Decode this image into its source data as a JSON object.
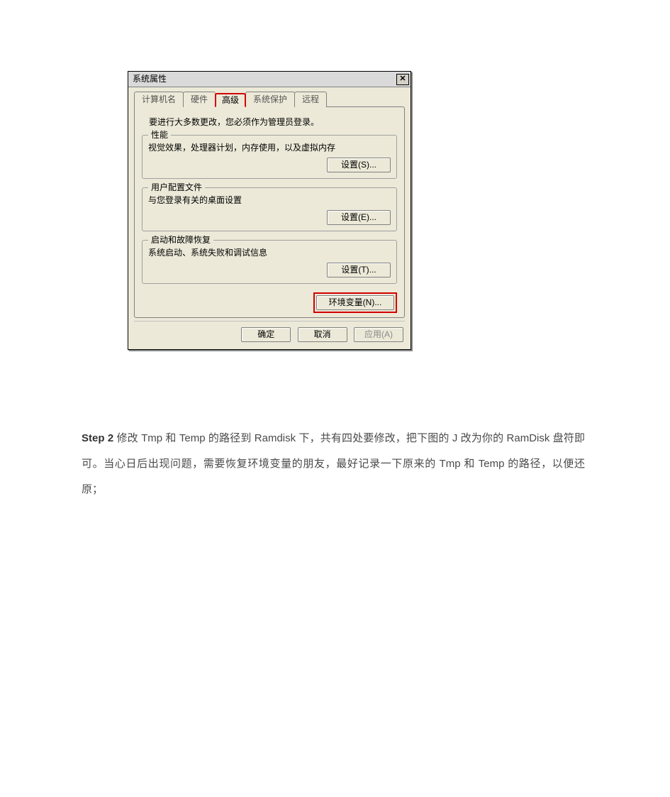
{
  "dialog": {
    "title": "系统属性",
    "close_glyph": "✕",
    "tabs": {
      "computer_name": "计算机名",
      "hardware": "硬件",
      "advanced": "高级",
      "system_protection": "系统保护",
      "remote": "远程"
    },
    "admin_note": "要进行大多数更改，您必须作为管理员登录。",
    "group_performance": {
      "legend": "性能",
      "desc": "视觉效果，处理器计划，内存使用，以及虚拟内存",
      "button": "设置(S)..."
    },
    "group_profiles": {
      "legend": "用户配置文件",
      "desc": "与您登录有关的桌面设置",
      "button": "设置(E)..."
    },
    "group_startup": {
      "legend": "启动和故障恢复",
      "desc": "系统启动、系统失败和调试信息",
      "button": "设置(T)..."
    },
    "env_button": "环境变量(N)...",
    "buttons": {
      "ok": "确定",
      "cancel": "取消",
      "apply": "应用(A)"
    }
  },
  "caption": {
    "step_label": "Step 2",
    "text": " 修改 Tmp 和 Temp 的路径到 Ramdisk 下，共有四处要修改，把下图的 J 改为你的 RamDisk 盘符即可。当心日后出现问题，需要恢复环境变量的朋友，最好记录一下原来的 Tmp 和 Temp 的路径，以便还原；"
  }
}
